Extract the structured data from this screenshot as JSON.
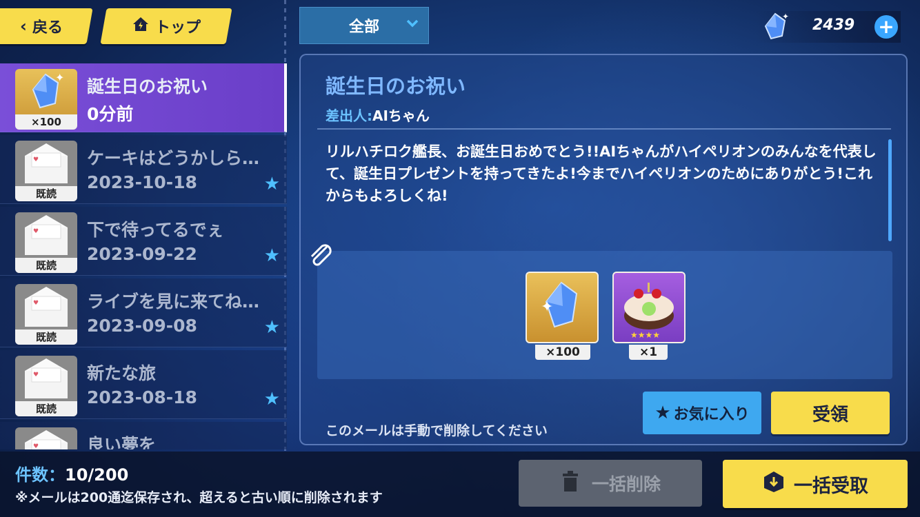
{
  "nav": {
    "back_label": "戻る",
    "top_label": "トップ"
  },
  "filter": {
    "selected": "全部"
  },
  "currency": {
    "amount": "2439",
    "add_label": "+"
  },
  "mail_list": [
    {
      "title": "誕生日のお祝い",
      "subtitle": "0分前",
      "badge": "×100",
      "starred": false,
      "active": true
    },
    {
      "title": "ケーキはどうかしら…",
      "subtitle": "2023-10-18",
      "badge": "既読",
      "starred": true,
      "active": false
    },
    {
      "title": "下で待ってるでぇ",
      "subtitle": "2023-09-22",
      "badge": "既読",
      "starred": true,
      "active": false
    },
    {
      "title": "ライブを見に来てね…",
      "subtitle": "2023-09-08",
      "badge": "既読",
      "starred": true,
      "active": false
    },
    {
      "title": "新たな旅",
      "subtitle": "2023-08-18",
      "badge": "既読",
      "starred": true,
      "active": false
    },
    {
      "title": "良い夢を",
      "subtitle": "",
      "badge": "",
      "starred": false,
      "active": false
    }
  ],
  "detail": {
    "title": "誕生日のお祝い",
    "sender_label": "差出人:",
    "sender": "AIちゃん",
    "body": "リルハチロク艦長、お誕生日おめでとう!!AIちゃんがハイペリオンのみんなを代表して、誕生日プレゼントを持ってきたよ!今までハイペリオンのためにありがとう!これからもよろしくね!",
    "rewards": [
      {
        "icon": "crystal-icon",
        "qty": "×100"
      },
      {
        "icon": "cake-icon",
        "qty": "×1",
        "stars": "★★★★"
      }
    ],
    "note": "このメールは手動で削除してください",
    "favorite_label": "お気に入り",
    "receive_label": "受領"
  },
  "footer": {
    "count_label": "件数：",
    "count_value": "10/200",
    "limit_note": "※メールは200通迄保存され、超えると古い順に削除されます",
    "bulk_delete_label": "一括削除",
    "bulk_receive_label": "一括受取"
  },
  "colors": {
    "accent_yellow": "#f8dc4b",
    "accent_blue": "#3ea8f0",
    "active_purple": "#7a4fd8"
  }
}
